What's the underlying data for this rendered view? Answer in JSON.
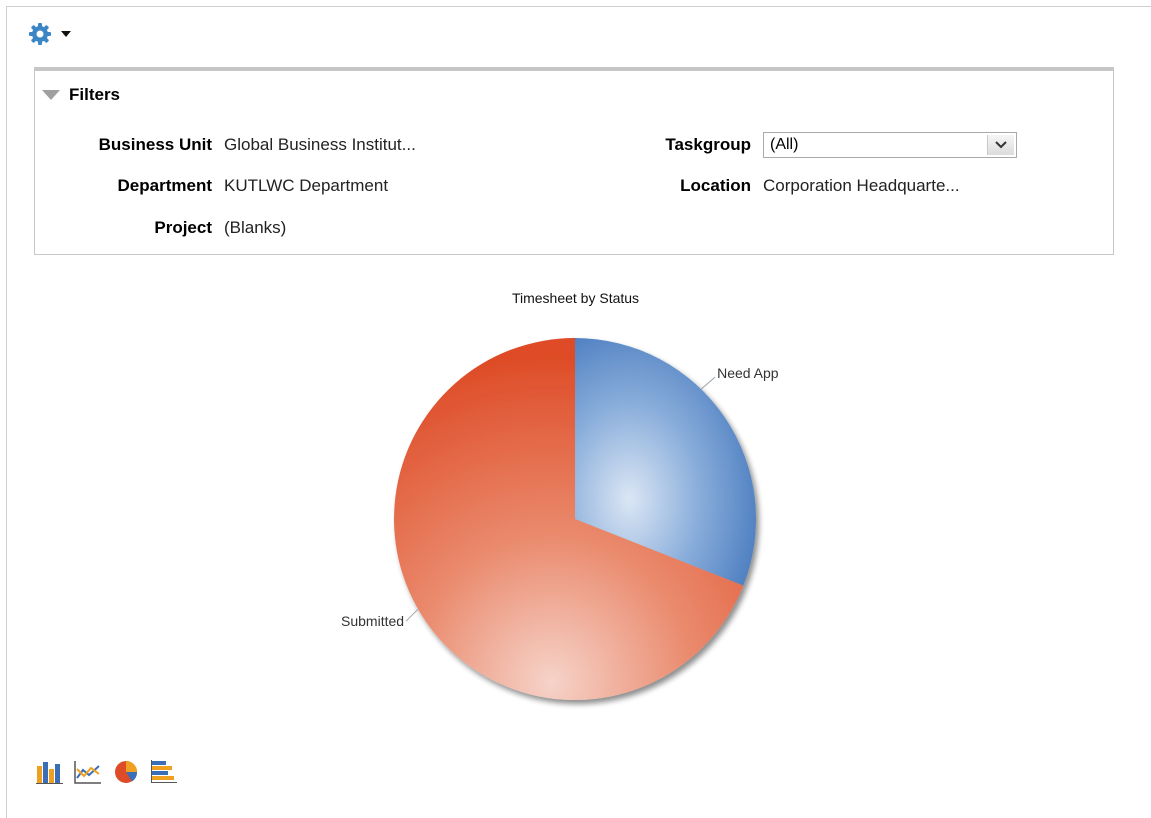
{
  "toolbar": {
    "gear_icon": "gear-icon",
    "menu_caret": "caret-down-icon"
  },
  "filters": {
    "title": "Filters",
    "fields": {
      "business_unit": {
        "label": "Business Unit",
        "value": "Global Business Institut..."
      },
      "department": {
        "label": "Department",
        "value": "KUTLWC Department"
      },
      "project": {
        "label": "Project",
        "value": "(Blanks)"
      },
      "taskgroup": {
        "label": "Taskgroup",
        "value": "(All)"
      },
      "location": {
        "label": "Location",
        "value": "Corporation Headquarte..."
      }
    }
  },
  "chart_data": {
    "type": "pie",
    "title": "Timesheet by Status",
    "slices": [
      {
        "label": "Need App",
        "value": 31,
        "color": "#3a6fb8"
      },
      {
        "label": "Submitted",
        "value": 69,
        "color": "#de4c27"
      }
    ]
  },
  "chart_type_buttons": [
    "bar-chart-icon",
    "line-chart-icon",
    "pie-chart-icon",
    "horizontal-bar-chart-icon"
  ]
}
